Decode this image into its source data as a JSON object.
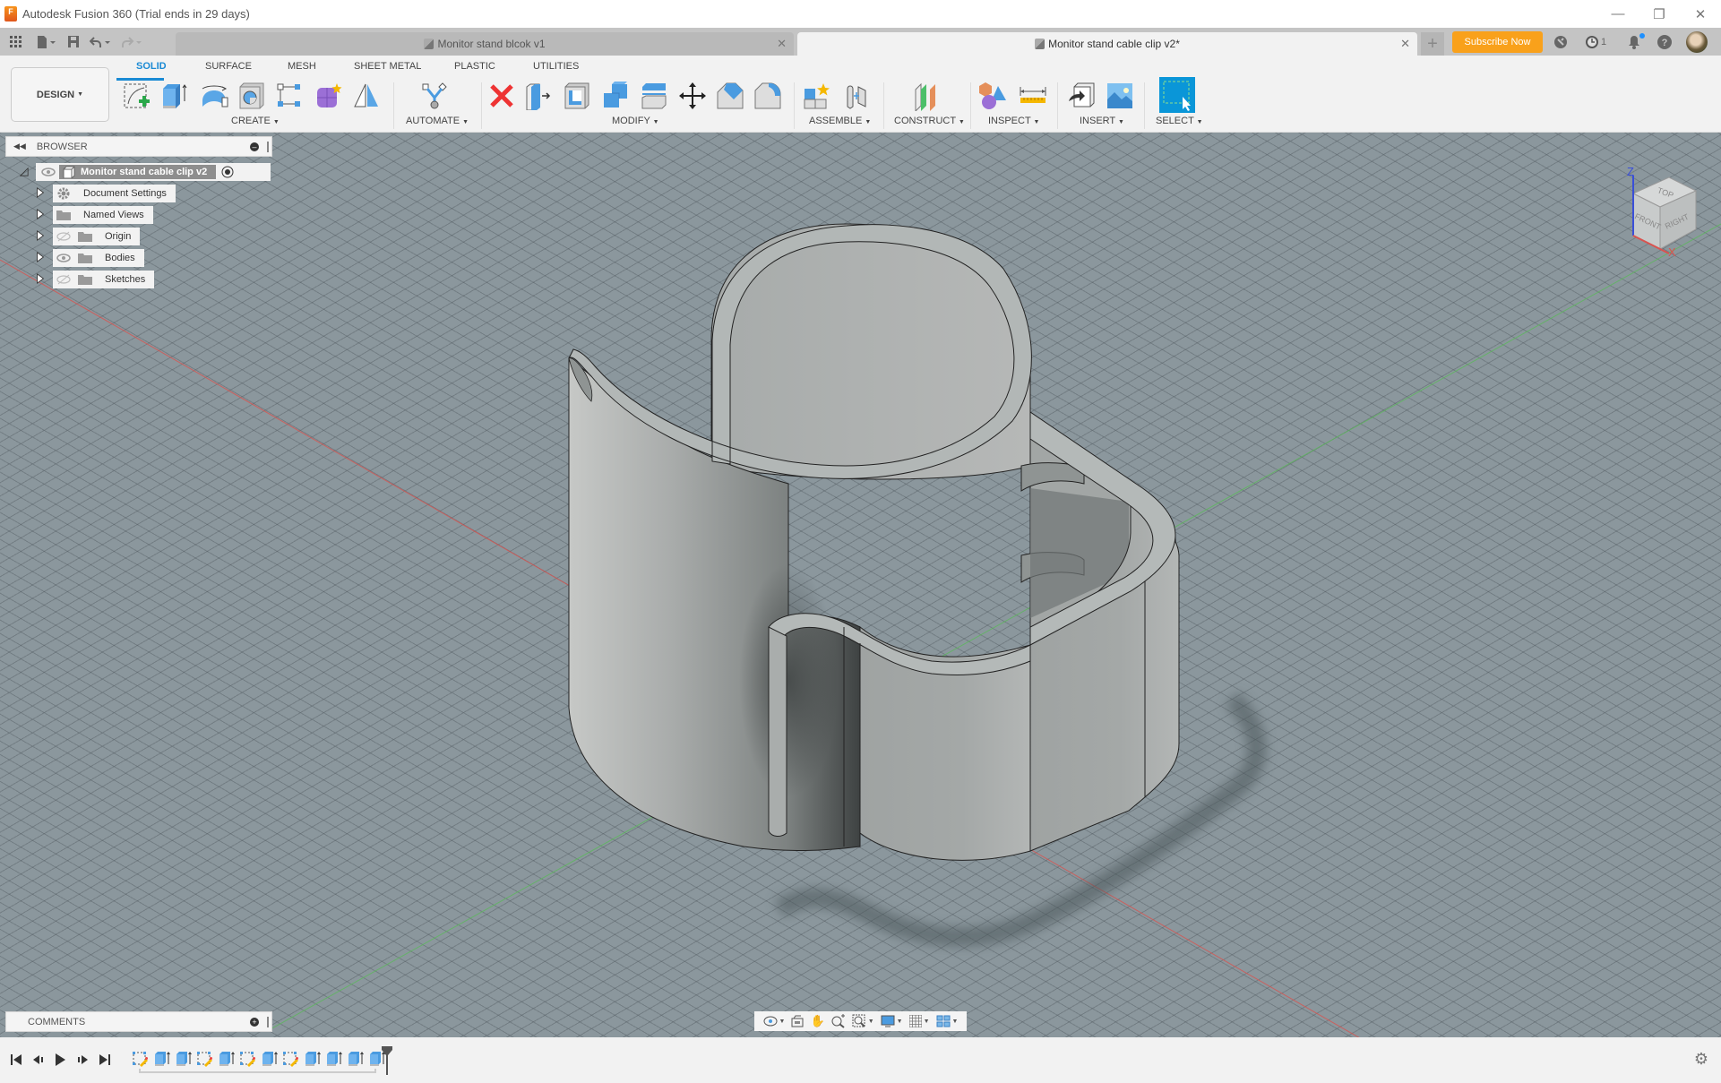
{
  "window": {
    "title": "Autodesk Fusion 360 (Trial ends in 29 days)",
    "app_icon": "fusion-360-logo",
    "controls": [
      "minimize",
      "restore",
      "close"
    ]
  },
  "quick_access": {
    "icons": [
      "data-panel-grid-icon",
      "file-icon",
      "save-icon",
      "undo-icon",
      "redo-icon"
    ]
  },
  "tabs": [
    {
      "label": "Monitor stand blcok v1",
      "active": false
    },
    {
      "label": "Monitor stand cable clip v2*",
      "active": true
    }
  ],
  "header_right": {
    "subscribe_label": "Subscribe Now",
    "job_status_count": "1",
    "icons": [
      "new-tab-plus-icon",
      "extensions-icon",
      "job-status-clock-icon",
      "notifications-bell-icon",
      "help-icon",
      "user-avatar"
    ]
  },
  "toolbar": {
    "workspace_label": "DESIGN",
    "ribbon_tabs": [
      {
        "label": "SOLID",
        "active": true
      },
      {
        "label": "SURFACE",
        "active": false
      },
      {
        "label": "MESH",
        "active": false
      },
      {
        "label": "SHEET METAL",
        "active": false
      },
      {
        "label": "PLASTIC",
        "active": false
      },
      {
        "label": "UTILITIES",
        "active": false
      }
    ],
    "groups": [
      {
        "label": "CREATE",
        "tools": [
          "create-sketch",
          "extrude",
          "revolve",
          "hole",
          "rectangular-pattern",
          "create-form",
          "mirror"
        ]
      },
      {
        "label": "AUTOMATE",
        "tools": [
          "automated-modeling"
        ]
      },
      {
        "label": "MODIFY",
        "tools": [
          "delete",
          "press-pull",
          "shell",
          "combine",
          "offset-face",
          "move-copy",
          "chamfer",
          "fillet"
        ]
      },
      {
        "label": "ASSEMBLE",
        "tools": [
          "new-component",
          "joint"
        ]
      },
      {
        "label": "CONSTRUCT",
        "tools": [
          "offset-plane"
        ]
      },
      {
        "label": "INSPECT",
        "tools": [
          "interference",
          "measure"
        ]
      },
      {
        "label": "INSERT",
        "tools": [
          "insert-derive",
          "insert-canvas"
        ]
      },
      {
        "label": "SELECT",
        "tools": [
          "window-select"
        ]
      }
    ]
  },
  "browser": {
    "title": "BROWSER",
    "root": {
      "label": "Monitor stand cable clip v2"
    },
    "items": [
      {
        "label": "Document Settings",
        "icon": "gear-icon",
        "visibility": "none"
      },
      {
        "label": "Named Views",
        "icon": "folder-icon",
        "visibility": "none"
      },
      {
        "label": "Origin",
        "icon": "folder-icon",
        "visibility": "hidden"
      },
      {
        "label": "Bodies",
        "icon": "folder-icon",
        "visibility": "visible"
      },
      {
        "label": "Sketches",
        "icon": "folder-icon",
        "visibility": "hidden"
      }
    ]
  },
  "comments": {
    "title": "COMMENTS"
  },
  "viewcube": {
    "faces": [
      "TOP",
      "FRONT",
      "RIGHT"
    ],
    "axes": [
      "Z",
      "X"
    ]
  },
  "navbar": {
    "tools": [
      "orbit",
      "look-at",
      "pan",
      "zoom",
      "fit-window",
      "display-settings",
      "grid-snap",
      "viewports"
    ]
  },
  "timeline": {
    "controls": [
      "go-to-start",
      "step-back",
      "play",
      "step-forward",
      "go-to-end"
    ],
    "features": [
      "sketch",
      "extrude",
      "extrude",
      "sketch",
      "extrude",
      "sketch",
      "extrude",
      "sketch",
      "extrude",
      "extrude",
      "extrude",
      "extrude"
    ]
  },
  "colors": {
    "accent": "#1a8ad4",
    "subscribe": "#f9a11b",
    "viewport_bg": "#8b979d",
    "model": "#a3a7a6",
    "x_axis": "#d9534f",
    "y_axis": "#5cb85c",
    "z_axis": "#3a4fd8"
  }
}
